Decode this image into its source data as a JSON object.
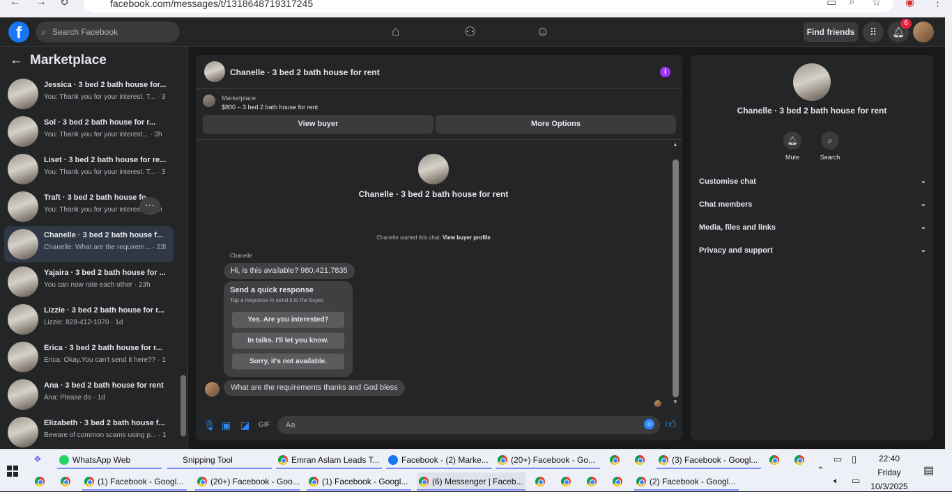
{
  "browser": {
    "url": "facebook.com/messages/t/1318648719317245"
  },
  "topbar": {
    "logo": "f",
    "search_placeholder": "Search Facebook",
    "find_friends": "Find friends",
    "notification_count": "6",
    "icons": [
      "home-icon",
      "friends-icon",
      "groups-icon",
      "menu-grid-icon",
      "bell-icon",
      "messenger-icon"
    ]
  },
  "sidebar": {
    "title": "Marketplace",
    "conversations": [
      {
        "title": "Jessica · 3 bed 2 bath house for...",
        "preview": "You: Thank you for your interest. T... · 3h"
      },
      {
        "title": "Sol · 3 bed 2 bath house for r...",
        "preview": "You: Thank you for your interest... · 3h"
      },
      {
        "title": "Liset · 3 bed 2 bath house for re...",
        "preview": "You: Thank you for your interest. T... · 3h"
      },
      {
        "title": "Traft · 3 bed 2 bath house fo...",
        "preview": "You: Thank you for your interest... · 3h"
      },
      {
        "title": "Chanelle · 3 bed 2 bath house f...",
        "preview": "Chanelle: What are the requirem... · 23h"
      },
      {
        "title": "Yajaira · 3 bed 2 bath house for ...",
        "preview": "You can now rate each other · 23h"
      },
      {
        "title": "Lizzie · 3 bed 2 bath house for r...",
        "preview": "Lizzie: 828-412-1070 · 1d"
      },
      {
        "title": "Erica · 3 bed 2 bath house for r...",
        "preview": "Erica: Okay.You can't send it here?? · 1d"
      },
      {
        "title": "Ana · 3 bed 2 bath house for rent",
        "preview": "Ana: Please do · 1d"
      },
      {
        "title": "Elizabeth · 3 bed 2 bath house f...",
        "preview": "Beware of common scams using p... · 1d"
      }
    ]
  },
  "chat": {
    "title": "Chanelle · 3 bed 2 bath house for rent",
    "marketplace_label": "Marketplace",
    "listing": "$800 – 3 bed 2 bath house for rent",
    "view_buyer": "View buyer",
    "more_options": "More Options",
    "intro_name": "Chanelle · 3 bed 2 bath house for rent",
    "started_text": "Chanelle started this chat.",
    "view_buyer_profile": "View buyer profile",
    "sender": "Chanelle",
    "message1": "Hi, is this available? 980.421.7835",
    "quick_title": "Send a quick response",
    "quick_sub": "Tap a response to send it to the buyer.",
    "quick_options": [
      "Yes. Are you interested?",
      "In talks. I'll let you know.",
      "Sorry, it's not available."
    ],
    "message2": "What are the requirements thanks and God bless",
    "composer_placeholder": "Aa"
  },
  "details": {
    "name": "Chanelle · 3 bed 2 bath house for rent",
    "mute": "Mute",
    "search": "Search",
    "sections": [
      "Customise chat",
      "Chat members",
      "Media, files and links",
      "Privacy and support"
    ]
  },
  "taskbar": {
    "row1": [
      "WhatsApp Web",
      "Snipping Tool",
      "Emran Aslam Leads T...",
      "Facebook - (2) Marke...",
      "(20+) Facebook - Go...",
      "(3) Facebook - Googl..."
    ],
    "row2": [
      "(1) Facebook - Googl...",
      "(20+) Facebook - Goo...",
      "(1) Facebook - Googl...",
      "(6) Messenger | Faceb...",
      "(2) Facebook - Googl..."
    ],
    "time": "22:40",
    "day": "Friday",
    "date": "10/3/2025"
  },
  "colors": {
    "accent": "#2d88ff",
    "brand": "#1877f2",
    "info": "#a033ff",
    "badge": "#e41e3f"
  }
}
